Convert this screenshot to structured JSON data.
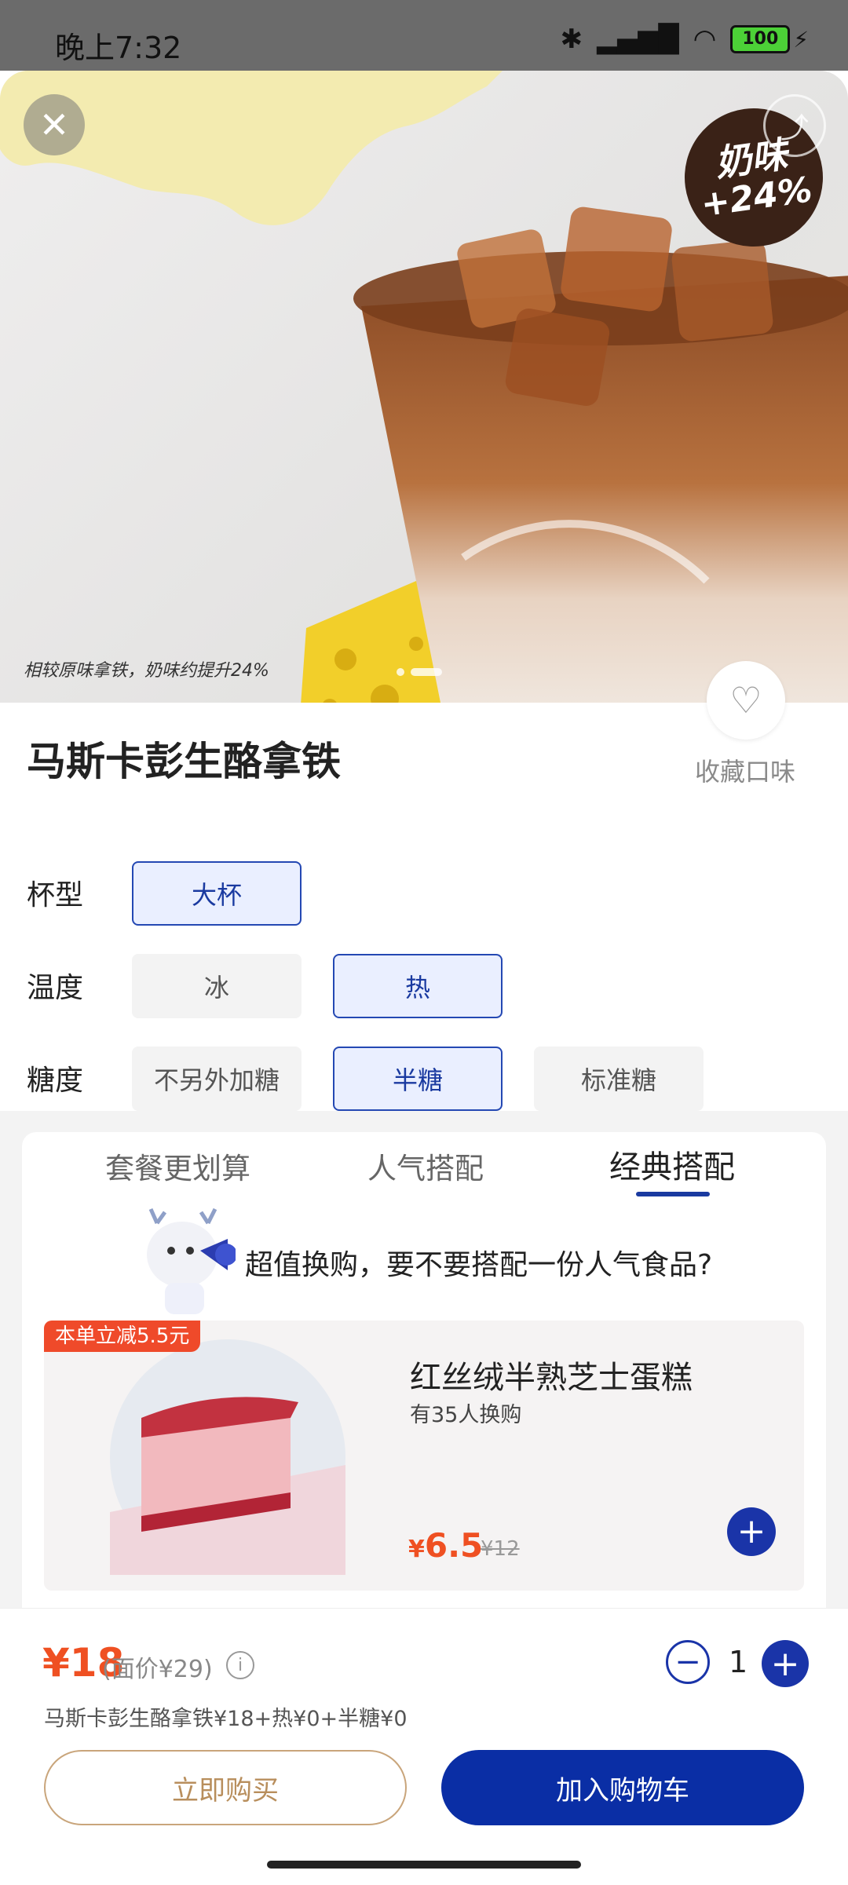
{
  "status_bar": {
    "time": "晚上7:32",
    "battery": "100"
  },
  "hero": {
    "badge_line1": "奶味",
    "badge_line2": "+24%",
    "caption": "相较原味拿铁，奶味约提升24%"
  },
  "product": {
    "title": "马斯卡彭生酪拿铁",
    "favorite_label": "收藏口味"
  },
  "options": [
    {
      "label": "杯型",
      "choices": [
        "大杯"
      ],
      "selected": "大杯"
    },
    {
      "label": "温度",
      "choices": [
        "冰",
        "热"
      ],
      "selected": "热"
    },
    {
      "label": "糖度",
      "choices": [
        "不另外加糖",
        "半糖",
        "标准糖"
      ],
      "selected": "半糖"
    }
  ],
  "tabs": [
    "套餐更划算",
    "人气搭配",
    "经典搭配"
  ],
  "active_tab": "经典搭配",
  "promo_text": "超值换购，要不要搭配一份人气食品?",
  "addon": {
    "discount_tag": "本单立减5.5元",
    "name": "红丝绒半熟芝士蛋糕",
    "buyers": "有35人换购",
    "price_symbol": "¥",
    "price": "6.5",
    "original_price": "¥12"
  },
  "bottom": {
    "price": "¥18",
    "price_note": "(面价¥29)",
    "quantity": "1",
    "summary": "马斯卡彭生酪拿铁¥18+热¥0+半糖¥0",
    "buy_now": "立即购买",
    "add_cart": "加入购物车"
  },
  "colors": {
    "accent": "#1a34a8",
    "price": "#ef5022",
    "gold": "#c9a57b"
  }
}
